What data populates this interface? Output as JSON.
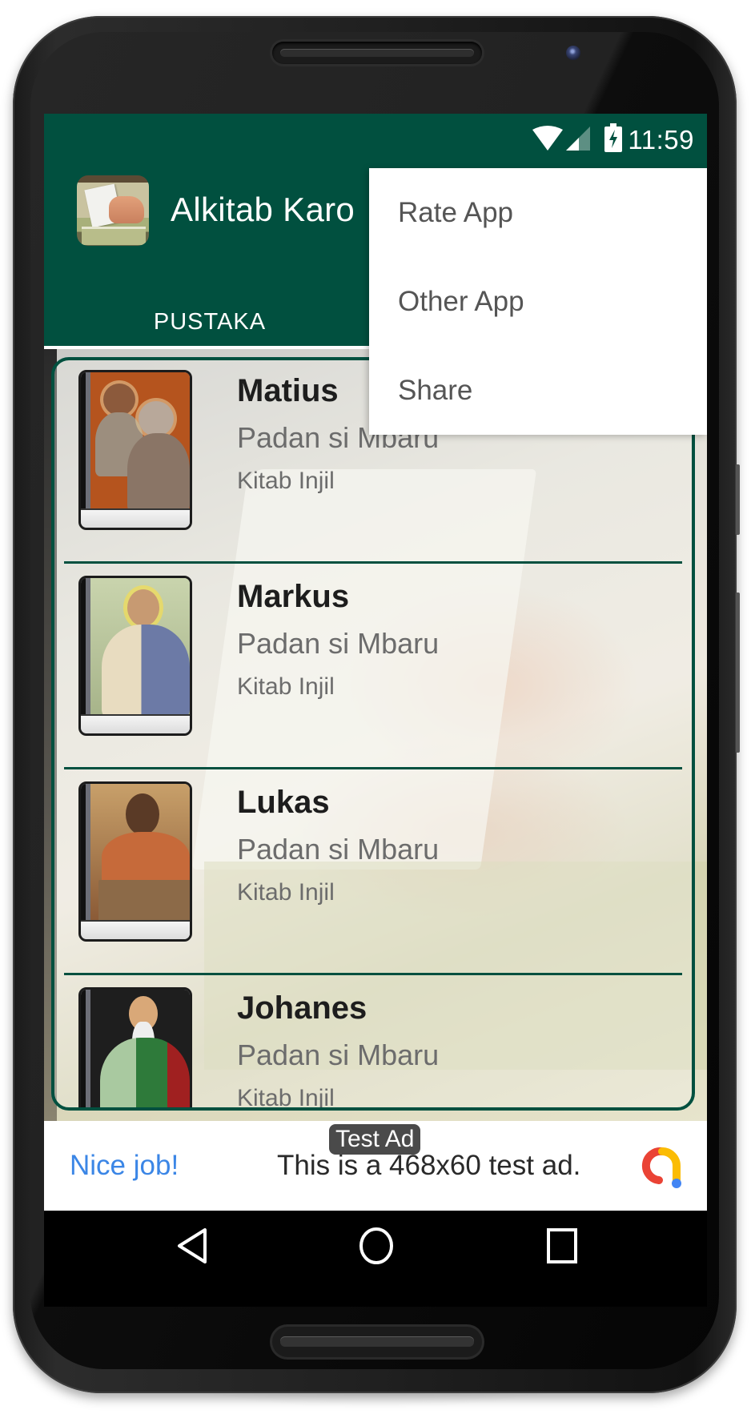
{
  "status_bar": {
    "time": "11:59",
    "icons": [
      "wifi-icon",
      "cell-signal-icon",
      "battery-charging-icon"
    ]
  },
  "app_bar": {
    "title": "Alkitab Karo",
    "icon": "app-logo-bible-hand"
  },
  "tabs": [
    {
      "label": "PUSTAKA",
      "selected": true
    }
  ],
  "overflow_menu": {
    "items": [
      {
        "label": "Rate App"
      },
      {
        "label": "Other App"
      },
      {
        "label": "Share"
      }
    ]
  },
  "books": [
    {
      "title": "Matius",
      "subtitle": "Padan si Mbaru",
      "category": "Kitab Injil",
      "cover": "saint-matthew-with-angel"
    },
    {
      "title": "Markus",
      "subtitle": "Padan si Mbaru",
      "category": "Kitab Injil",
      "cover": "saint-mark"
    },
    {
      "title": "Lukas",
      "subtitle": "Padan si Mbaru",
      "category": "Kitab Injil",
      "cover": "saint-luke"
    },
    {
      "title": "Johanes",
      "subtitle": "Padan si Mbaru",
      "category": "Kitab Injil",
      "cover": "saint-john"
    }
  ],
  "ad": {
    "badge": "Test Ad",
    "headline": "Nice job!",
    "text": "This is a 468x60 test ad.",
    "logo": "admob-logo"
  },
  "nav_bar": {
    "buttons": [
      "back",
      "home",
      "recents"
    ]
  },
  "colors": {
    "primary": "#01503f",
    "ad_headline": "#3b86e6",
    "menu_text": "#555555"
  }
}
